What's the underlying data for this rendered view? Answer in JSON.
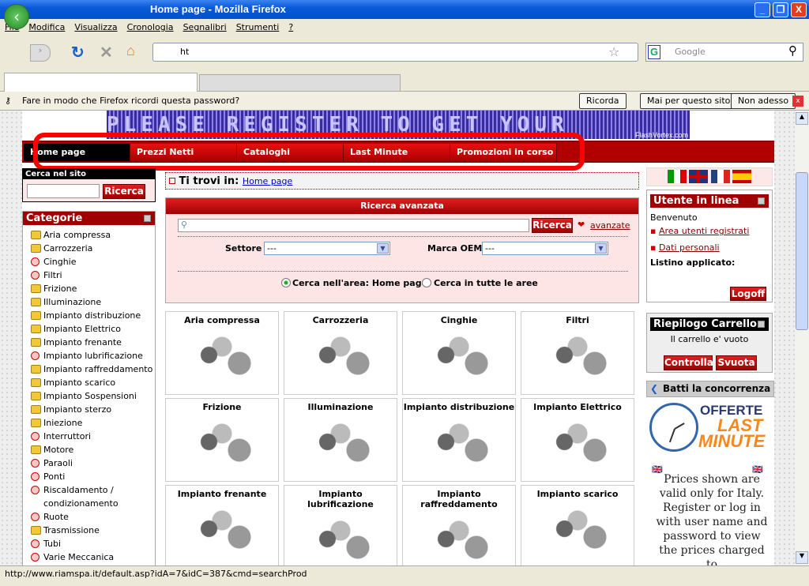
{
  "window": {
    "title": "Home page - Mozilla Firefox",
    "min": "_",
    "max": "❐",
    "close": "X"
  },
  "menu": [
    "File",
    "Modifica",
    "Visualizza",
    "Cronologia",
    "Segnalibri",
    "Strumenti",
    "?"
  ],
  "toolbar": {
    "url": "ht",
    "search_placeholder": "Google"
  },
  "notification": {
    "text": "Fare in modo che Firefox ricordi questa password?",
    "remember": "Ricorda",
    "never": "Mai per questo sito",
    "not_now": "Non adesso"
  },
  "banner": {
    "text": "PLEASE REGISTER TO GET YOUR",
    "credit": "FlashVortex.com"
  },
  "nav": [
    "Home page",
    "Prezzi Netti",
    "Cataloghi",
    "Last Minute",
    "Promozioni in corso"
  ],
  "site_search": {
    "title": "Cerca nel sito",
    "button": "Ricerca"
  },
  "categories": {
    "title": "Categorie",
    "items": [
      {
        "label": "Aria compressa",
        "icon": "folder"
      },
      {
        "label": "Carrozzeria",
        "icon": "folder"
      },
      {
        "label": "Cinghie",
        "icon": "circle"
      },
      {
        "label": "Filtri",
        "icon": "circle"
      },
      {
        "label": "Frizione",
        "icon": "folder"
      },
      {
        "label": "Illuminazione",
        "icon": "folder"
      },
      {
        "label": "Impianto distribuzione",
        "icon": "folder"
      },
      {
        "label": "Impianto Elettrico",
        "icon": "folder"
      },
      {
        "label": "Impianto frenante",
        "icon": "folder"
      },
      {
        "label": "Impianto lubrificazione",
        "icon": "circle"
      },
      {
        "label": "Impianto raffreddamento",
        "icon": "folder"
      },
      {
        "label": "Impianto scarico",
        "icon": "folder"
      },
      {
        "label": "Impianto Sospensioni",
        "icon": "folder"
      },
      {
        "label": "Impianto sterzo",
        "icon": "folder"
      },
      {
        "label": "Iniezione",
        "icon": "folder"
      },
      {
        "label": "Interruttori",
        "icon": "circle"
      },
      {
        "label": "Motore",
        "icon": "folder"
      },
      {
        "label": "Paraoli",
        "icon": "circle"
      },
      {
        "label": "Ponti",
        "icon": "circle"
      },
      {
        "label": "Riscaldamento / condizionamento",
        "icon": "circle"
      },
      {
        "label": "Ruote",
        "icon": "circle"
      },
      {
        "label": "Trasmissione",
        "icon": "folder"
      },
      {
        "label": "Tubi",
        "icon": "circle"
      },
      {
        "label": "Varie Meccanica",
        "icon": "circle"
      }
    ]
  },
  "breadcrumb": {
    "label": "Ti trovi in:",
    "link": "Home page"
  },
  "advanced_search": {
    "title": "Ricerca avanzata",
    "button": "Ricerca",
    "advanced_link": "avanzate",
    "sector_label": "Settore",
    "sector_value": "---",
    "oem_label": "Marca OEM",
    "oem_value": "---",
    "radio_area": "Cerca nell'area: Home page",
    "radio_all": "Cerca in tutte le aree"
  },
  "products": [
    "Aria compressa",
    "Carrozzeria",
    "Cinghie",
    "Filtri",
    "Frizione",
    "Illuminazione",
    "Impianto distribuzione",
    "Impianto Elettrico",
    "Impianto frenante",
    "Impianto lubrificazione",
    "Impianto raffreddamento",
    "Impianto scarico"
  ],
  "user": {
    "title": "Utente in linea",
    "welcome": "Benvenuto",
    "links": [
      "Area utenti registrati",
      "Dati personali"
    ],
    "pricelist_label": "Listino applicato:",
    "logoff": "Logoff"
  },
  "cart": {
    "title": "Riepilogo Carrello",
    "empty": "Il carrello e' vuoto",
    "check": "Controlla",
    "empty_btn": "Svuota"
  },
  "promo": {
    "title": "Batti la concorrenza",
    "offerte": "OFFERTE",
    "last": "LAST",
    "minute": "MINUTE",
    "notice": "Prices shown are valid only for Italy. Register or log in with user name and password to view the prices charged to"
  },
  "status": "http://www.riamspa.it/default.asp?idA=7&idC=387&cmd=searchProd"
}
